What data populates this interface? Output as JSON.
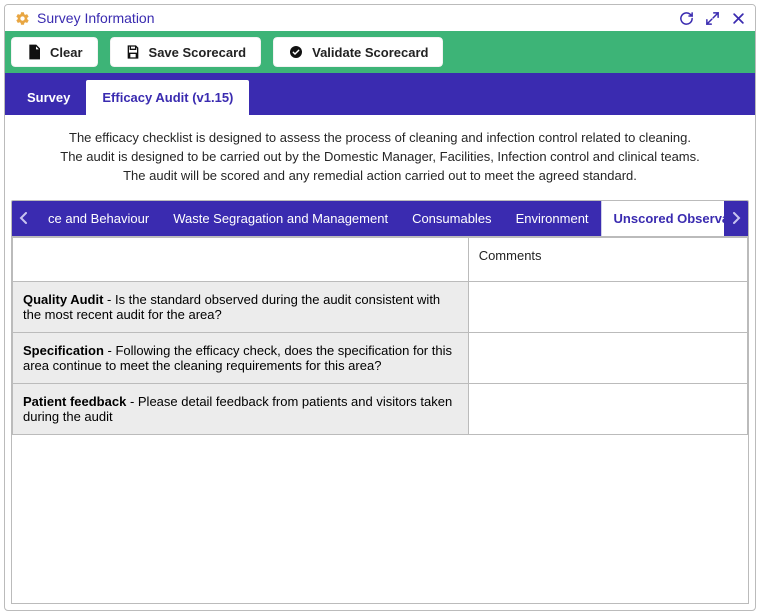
{
  "header": {
    "title": "Survey Information"
  },
  "toolbar": {
    "clear": "Clear",
    "save": "Save Scorecard",
    "validate": "Validate Scorecard"
  },
  "tabs": {
    "survey": "Survey",
    "efficacy": "Efficacy Audit (v1.15)"
  },
  "description": {
    "line1": "The efficacy checklist is designed to assess the process of cleaning and infection control related to cleaning.",
    "line2": "The audit is designed to be carried out by the Domestic Manager, Facilities, Infection control and clinical teams.",
    "line3": "The audit will be scored and any remedial action carried out to meet the agreed standard."
  },
  "subtabs": {
    "items": [
      "ce and Behaviour",
      "Waste Segragation and Management",
      "Consumables",
      "Environment",
      "Unscored Observations"
    ]
  },
  "table": {
    "col_comments": "Comments",
    "rows": [
      {
        "label": "Quality Audit",
        "text": " - Is the standard observed during the audit consistent with the most recent audit for the area?"
      },
      {
        "label": "Specification",
        "text": " - Following the efficacy check, does the specification for this area continue to meet the cleaning requirements for this area?"
      },
      {
        "label": "Patient feedback",
        "text": " - Please detail feedback from patients and visitors taken during the audit"
      }
    ]
  }
}
